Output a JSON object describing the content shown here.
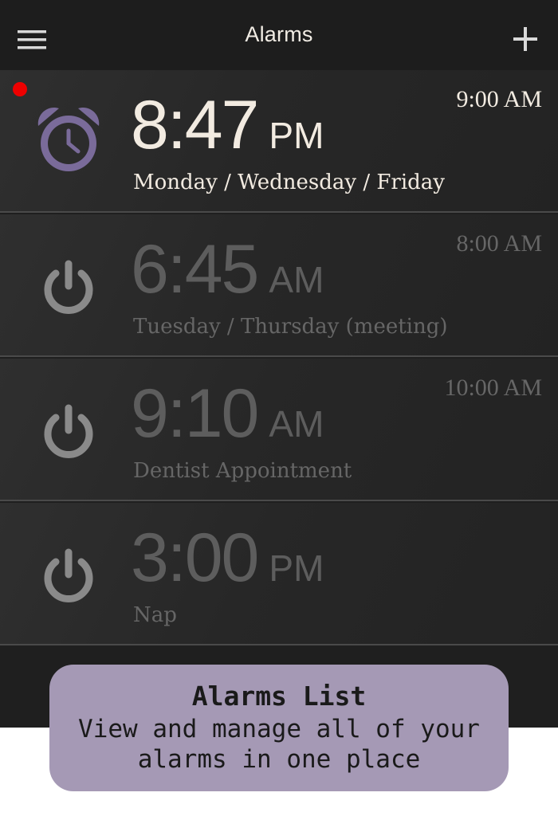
{
  "header": {
    "title": "Alarms",
    "menu_icon": "hamburger-menu-icon",
    "add_icon": "plus-icon"
  },
  "alarms": [
    {
      "time": "8:47",
      "ampm": "PM",
      "label": "Monday / Wednesday / Friday",
      "next": "9:00 AM",
      "state": "active",
      "icon": "alarm-clock-icon"
    },
    {
      "time": "6:45",
      "ampm": "AM",
      "label": "Tuesday / Thursday (meeting)",
      "next": "8:00 AM",
      "state": "inactive",
      "icon": "power-icon"
    },
    {
      "time": "9:10",
      "ampm": "AM",
      "label": "Dentist Appointment",
      "next": "10:00 AM",
      "state": "inactive",
      "icon": "power-icon"
    },
    {
      "time": "3:00",
      "ampm": "PM",
      "label": "Nap",
      "next": "",
      "state": "inactive",
      "icon": "power-icon"
    }
  ],
  "tooltip": {
    "title": "Alarms List",
    "body": "View and manage all of your alarms in one place"
  },
  "colors": {
    "background": "#1f1f1f",
    "accent": "#7a6b9a",
    "active_text": "#f2ebe1",
    "inactive_text": "#5d5d5d",
    "notification_dot": "#ee0000",
    "tooltip_bg": "#a599b5"
  }
}
